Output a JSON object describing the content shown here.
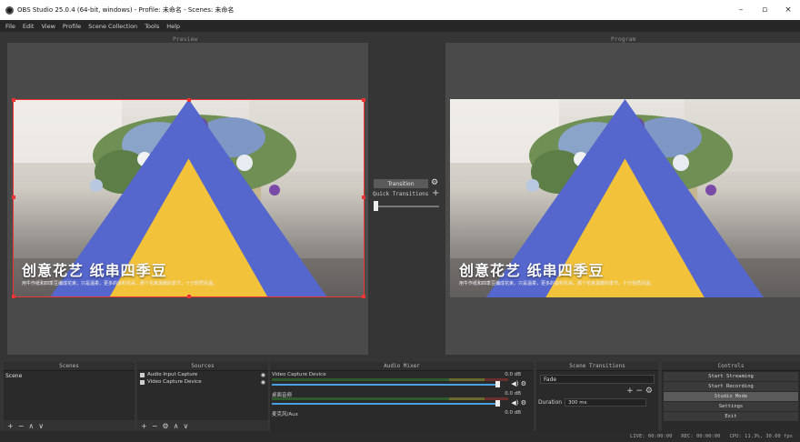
{
  "window": {
    "title": "OBS Studio 25.0.4 (64-bit, windows) - Profile: 未命名 - Scenes: 未命名",
    "minimize": "–",
    "maximize": "▫",
    "close": "×"
  },
  "menu": [
    "File",
    "Edit",
    "View",
    "Profile",
    "Scene Collection",
    "Tools",
    "Help"
  ],
  "preview": {
    "label": "Preview",
    "overlay_title": "创意花艺 纸串四季豆",
    "overlay_subtitle": "用牛作纸和四季豆编成花束，只是温柔，更多的染料花朵，那个花束温暖的季节，十分轻质而温。"
  },
  "program": {
    "label": "Program",
    "overlay_title": "创意花艺 纸串四季豆",
    "overlay_subtitle": "用牛作纸和四季豆编成花束，只是温柔，更多的染料花朵，那个花束温暖的季节，十分轻质而温。"
  },
  "transition": {
    "button_label": "Transition",
    "quick_label": "Quick Transitions",
    "tbar_level": 0.0
  },
  "scenes": {
    "header": "Scenes",
    "items": [
      "Scene"
    ]
  },
  "sources": {
    "header": "Sources",
    "items": [
      "Audio Input Capture",
      "Video Capture Device"
    ]
  },
  "mixer": {
    "header": "Audio Mixer",
    "tracks": [
      {
        "name": "Video Capture Device",
        "db": "0.0 dB",
        "level": 0.95
      },
      {
        "name": "桌面音频",
        "db": "0.0 dB",
        "level": 0.95
      },
      {
        "name": "麦克风/Aux",
        "db": "0.0 dB",
        "level": 0.95
      }
    ]
  },
  "scene_transitions": {
    "header": "Scene Transitions",
    "selected": "Fade",
    "duration_label": "Duration",
    "duration_value": "300 ms"
  },
  "controls": {
    "header": "Controls",
    "buttons": [
      "Start Streaming",
      "Start Recording",
      "Studio Mode",
      "Settings",
      "Exit"
    ]
  },
  "status": {
    "live": "LIVE: 00:00:00",
    "rec": "REC: 00:00:00",
    "cpu": "CPU: 11.3%, 30.00 fps"
  },
  "icons": {
    "gear": "gear-icon",
    "plus": "plus-icon",
    "minus": "minus-icon",
    "up": "arrow-up-icon",
    "down": "arrow-down-icon",
    "speaker": "speaker-icon",
    "eye": "eye-icon",
    "lock": "lock-icon"
  },
  "colors": {
    "selection": "#ee3333",
    "fader": "#4aa3e0",
    "pane_bg": "#4a4a4a"
  }
}
